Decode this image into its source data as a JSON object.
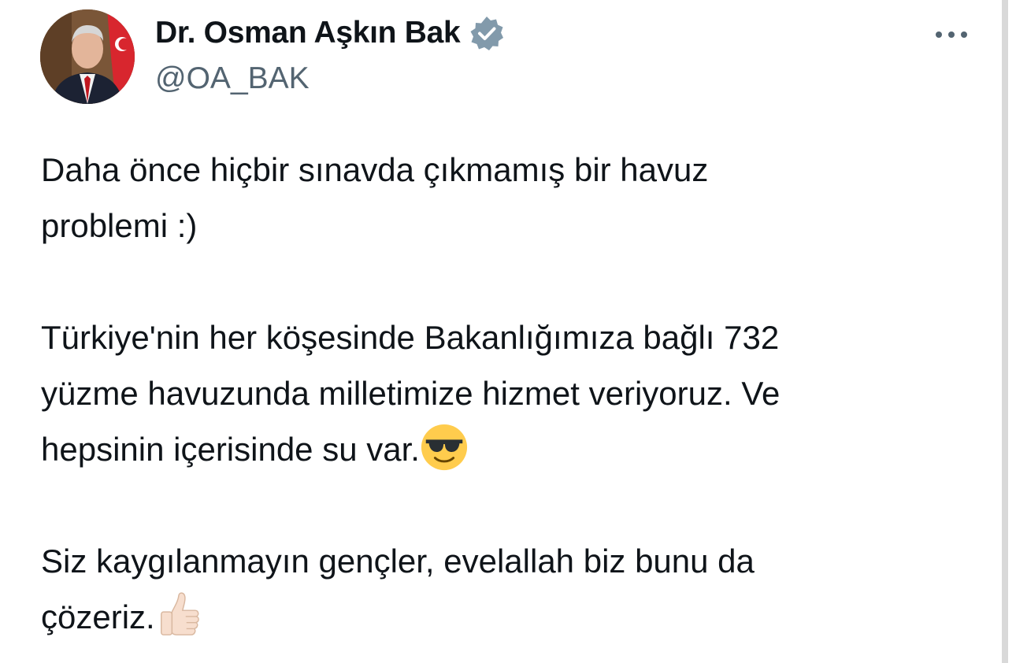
{
  "author": {
    "display_name": "Dr. Osman Aşkın Bak",
    "handle": "@OA_BAK",
    "verified": true,
    "avatar_icon": "profile-photo"
  },
  "menu": {
    "more_icon": "ellipsis-icon"
  },
  "tweet": {
    "paragraph1_line1": "Daha önce hiçbir sınavda çıkmamış bir havuz",
    "paragraph1_line2": "problemi :)",
    "paragraph2_line1": "Türkiye'nin her köşesinde Bakanlığımıza bağlı 732",
    "paragraph2_line2": "yüzme havuzunda milletimize hizmet veriyoruz. Ve",
    "paragraph2_line3": "hepsinin içerisinde su var.",
    "paragraph2_emoji": "sunglasses-face-emoji",
    "paragraph3_line1": "Siz kaygılanmayın gençler, evelallah biz bunu da",
    "paragraph3_line2": "çözeriz.",
    "paragraph3_emoji": "thumbs-up-emoji"
  },
  "colors": {
    "text_primary": "#0f1419",
    "text_secondary": "#536471",
    "verified_badge": "#829aab"
  }
}
